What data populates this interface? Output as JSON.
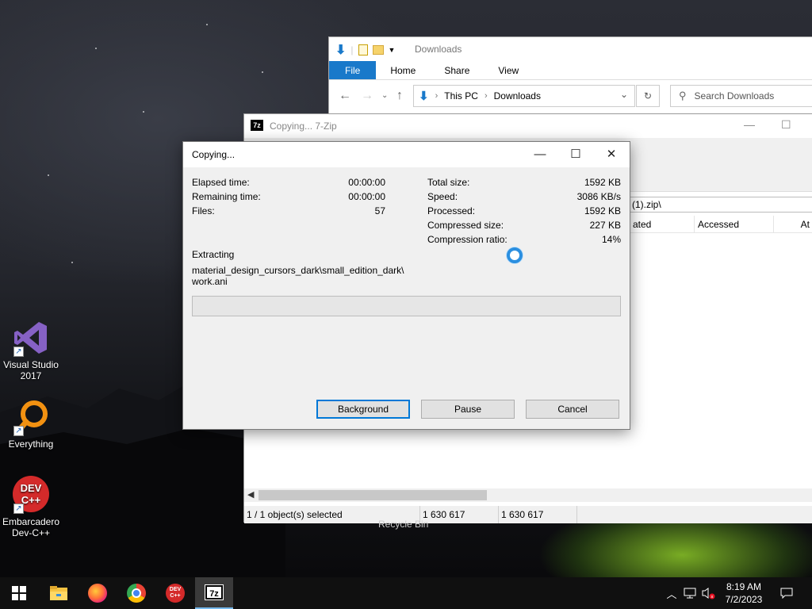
{
  "desktop": {
    "icons": [
      {
        "label": "Visual Studio 2017",
        "icon": "visual-studio-icon"
      },
      {
        "label": "Everything",
        "icon": "everything-search-icon"
      },
      {
        "label": "Embarcadero Dev-C++",
        "icon": "devcpp-icon",
        "badge": "DEV C++"
      }
    ],
    "recycle_bin_label": "Recycle Bin"
  },
  "explorer": {
    "title": "Downloads",
    "ribbon_tabs": [
      "File",
      "Home",
      "Share",
      "View"
    ],
    "breadcrumb": [
      "This PC",
      "Downloads"
    ],
    "search_placeholder": "Search Downloads",
    "accent": "#1979ca"
  },
  "zip_window": {
    "title": "Copying... 7-Zip",
    "logo": "7z",
    "path_fragment": "(1).zip\\",
    "columns": [
      "ated",
      "Accessed",
      "At"
    ],
    "status": {
      "selected": "1 / 1 object(s) selected",
      "size": "1 630 617",
      "packed": "1 630 617"
    }
  },
  "dialog": {
    "title": "Copying...",
    "left_stats": [
      {
        "label": "Elapsed time:",
        "value": "00:00:00"
      },
      {
        "label": "Remaining time:",
        "value": "00:00:00"
      },
      {
        "label": "Files:",
        "value": "57"
      }
    ],
    "right_stats": [
      {
        "label": "Total size:",
        "value": "1592 KB"
      },
      {
        "label": "Speed:",
        "value": "3086 KB/s"
      },
      {
        "label": "Processed:",
        "value": "1592 KB"
      },
      {
        "label": "Compressed size:",
        "value": "227 KB"
      },
      {
        "label": "Compression ratio:",
        "value": "14%"
      }
    ],
    "action": "Extracting",
    "file_line1": "material_design_cursors_dark\\small_edition_dark\\",
    "file_line2": "work.ani",
    "progress": 0,
    "buttons": {
      "background": "Background",
      "pause": "Pause",
      "cancel": "Cancel"
    }
  },
  "taskbar": {
    "apps": [
      "file-explorer-icon",
      "firefox-icon",
      "chrome-icon",
      "devcpp-icon",
      "7zip-icon"
    ],
    "active_app": "7zip-icon",
    "time": "8:19 AM",
    "date": "7/2/2023"
  }
}
